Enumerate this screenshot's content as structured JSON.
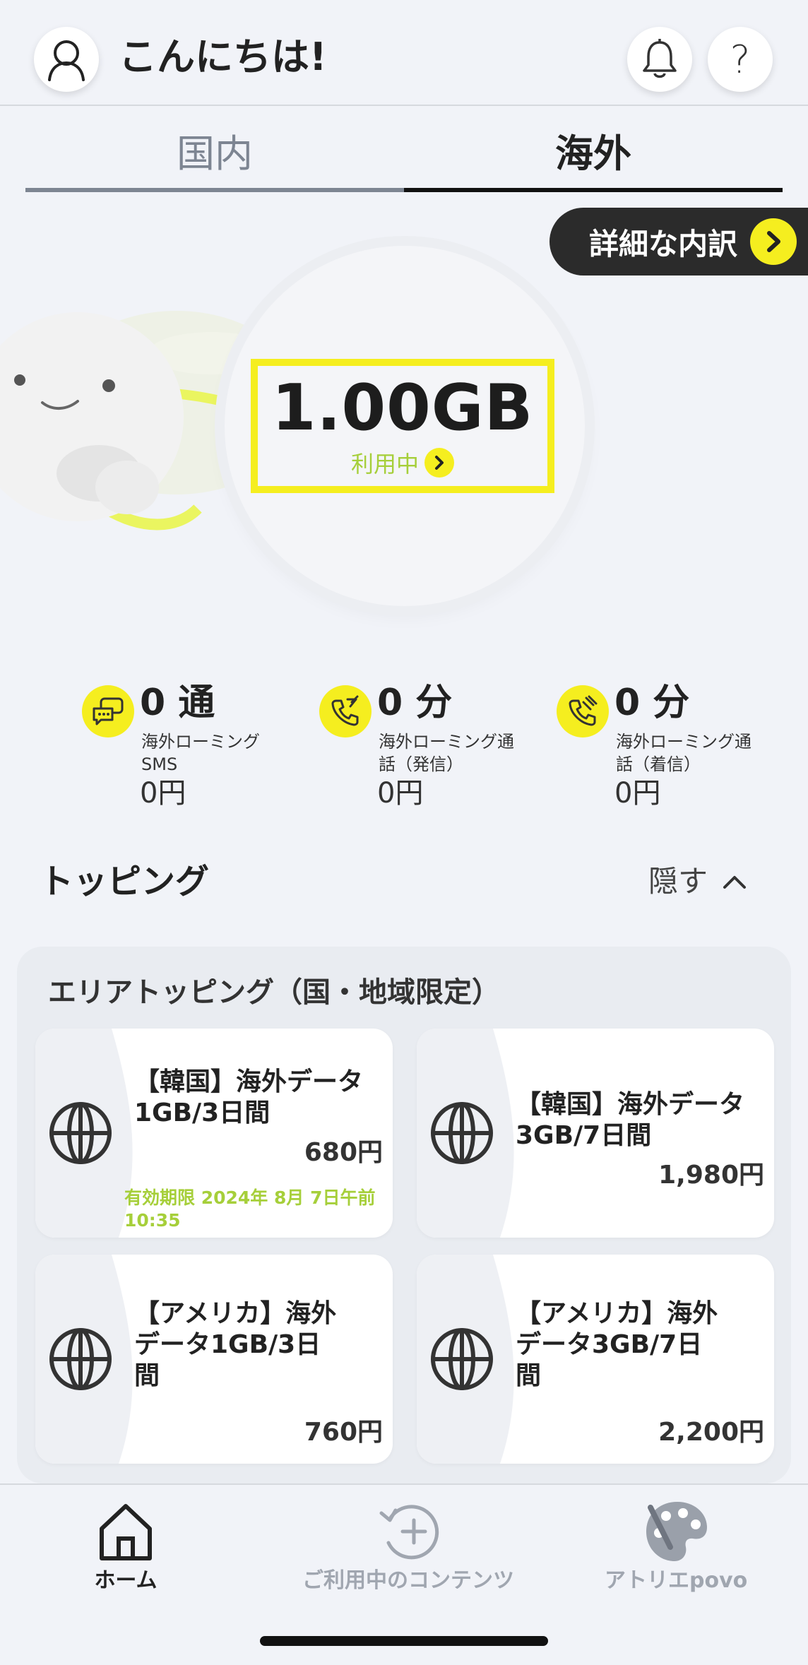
{
  "header": {
    "greeting": "こんにちは!",
    "avatar_icon": "user-icon",
    "bell_icon": "bell-icon",
    "help_label": "?"
  },
  "tabs": [
    {
      "label": "国内",
      "active": false
    },
    {
      "label": "海外",
      "active": true
    }
  ],
  "detail_button": {
    "label": "詳細な内訳",
    "icon": "chevron-right-icon"
  },
  "usage": {
    "value": "1.00GB",
    "status": "利用中"
  },
  "stats": [
    {
      "value": "0 通",
      "label": "海外ローミングSMS",
      "price": "0円",
      "icon": "sms-icon"
    },
    {
      "value": "0 分",
      "label": "海外ローミング通話（発信）",
      "price": "0円",
      "icon": "phone-outgoing-icon"
    },
    {
      "value": "0 分",
      "label": "海外ローミング通話（着信）",
      "price": "0円",
      "icon": "phone-incoming-icon"
    }
  ],
  "topping": {
    "title": "トッピング",
    "toggle_label": "隠す",
    "section_title": "エリアトッピング（国・地域限定）",
    "cards": [
      {
        "title": "【韓国】海外データ1GB/3日間",
        "price": "680円",
        "expiry": "有効期限 2024年 8月 7日午前10:35"
      },
      {
        "title": "【韓国】海外データ3GB/7日間",
        "price": "1,980円",
        "expiry": ""
      },
      {
        "title": "【アメリカ】海外データ1GB/3日間",
        "price": "760円",
        "expiry": ""
      },
      {
        "title": "【アメリカ】海外データ3GB/7日間",
        "price": "2,200円",
        "expiry": ""
      }
    ]
  },
  "bottom_nav": [
    {
      "label": "ホーム",
      "icon": "home-icon",
      "active": true
    },
    {
      "label": "ご利用中のコンテンツ",
      "icon": "add-content-icon",
      "active": false
    },
    {
      "label": "アトリエpovo",
      "icon": "palette-icon",
      "active": false
    }
  ],
  "colors": {
    "accent_yellow": "#f5ee1f",
    "accent_green": "#a6cf3a",
    "dark": "#2b2b2b",
    "background": "#f1f3f8"
  }
}
